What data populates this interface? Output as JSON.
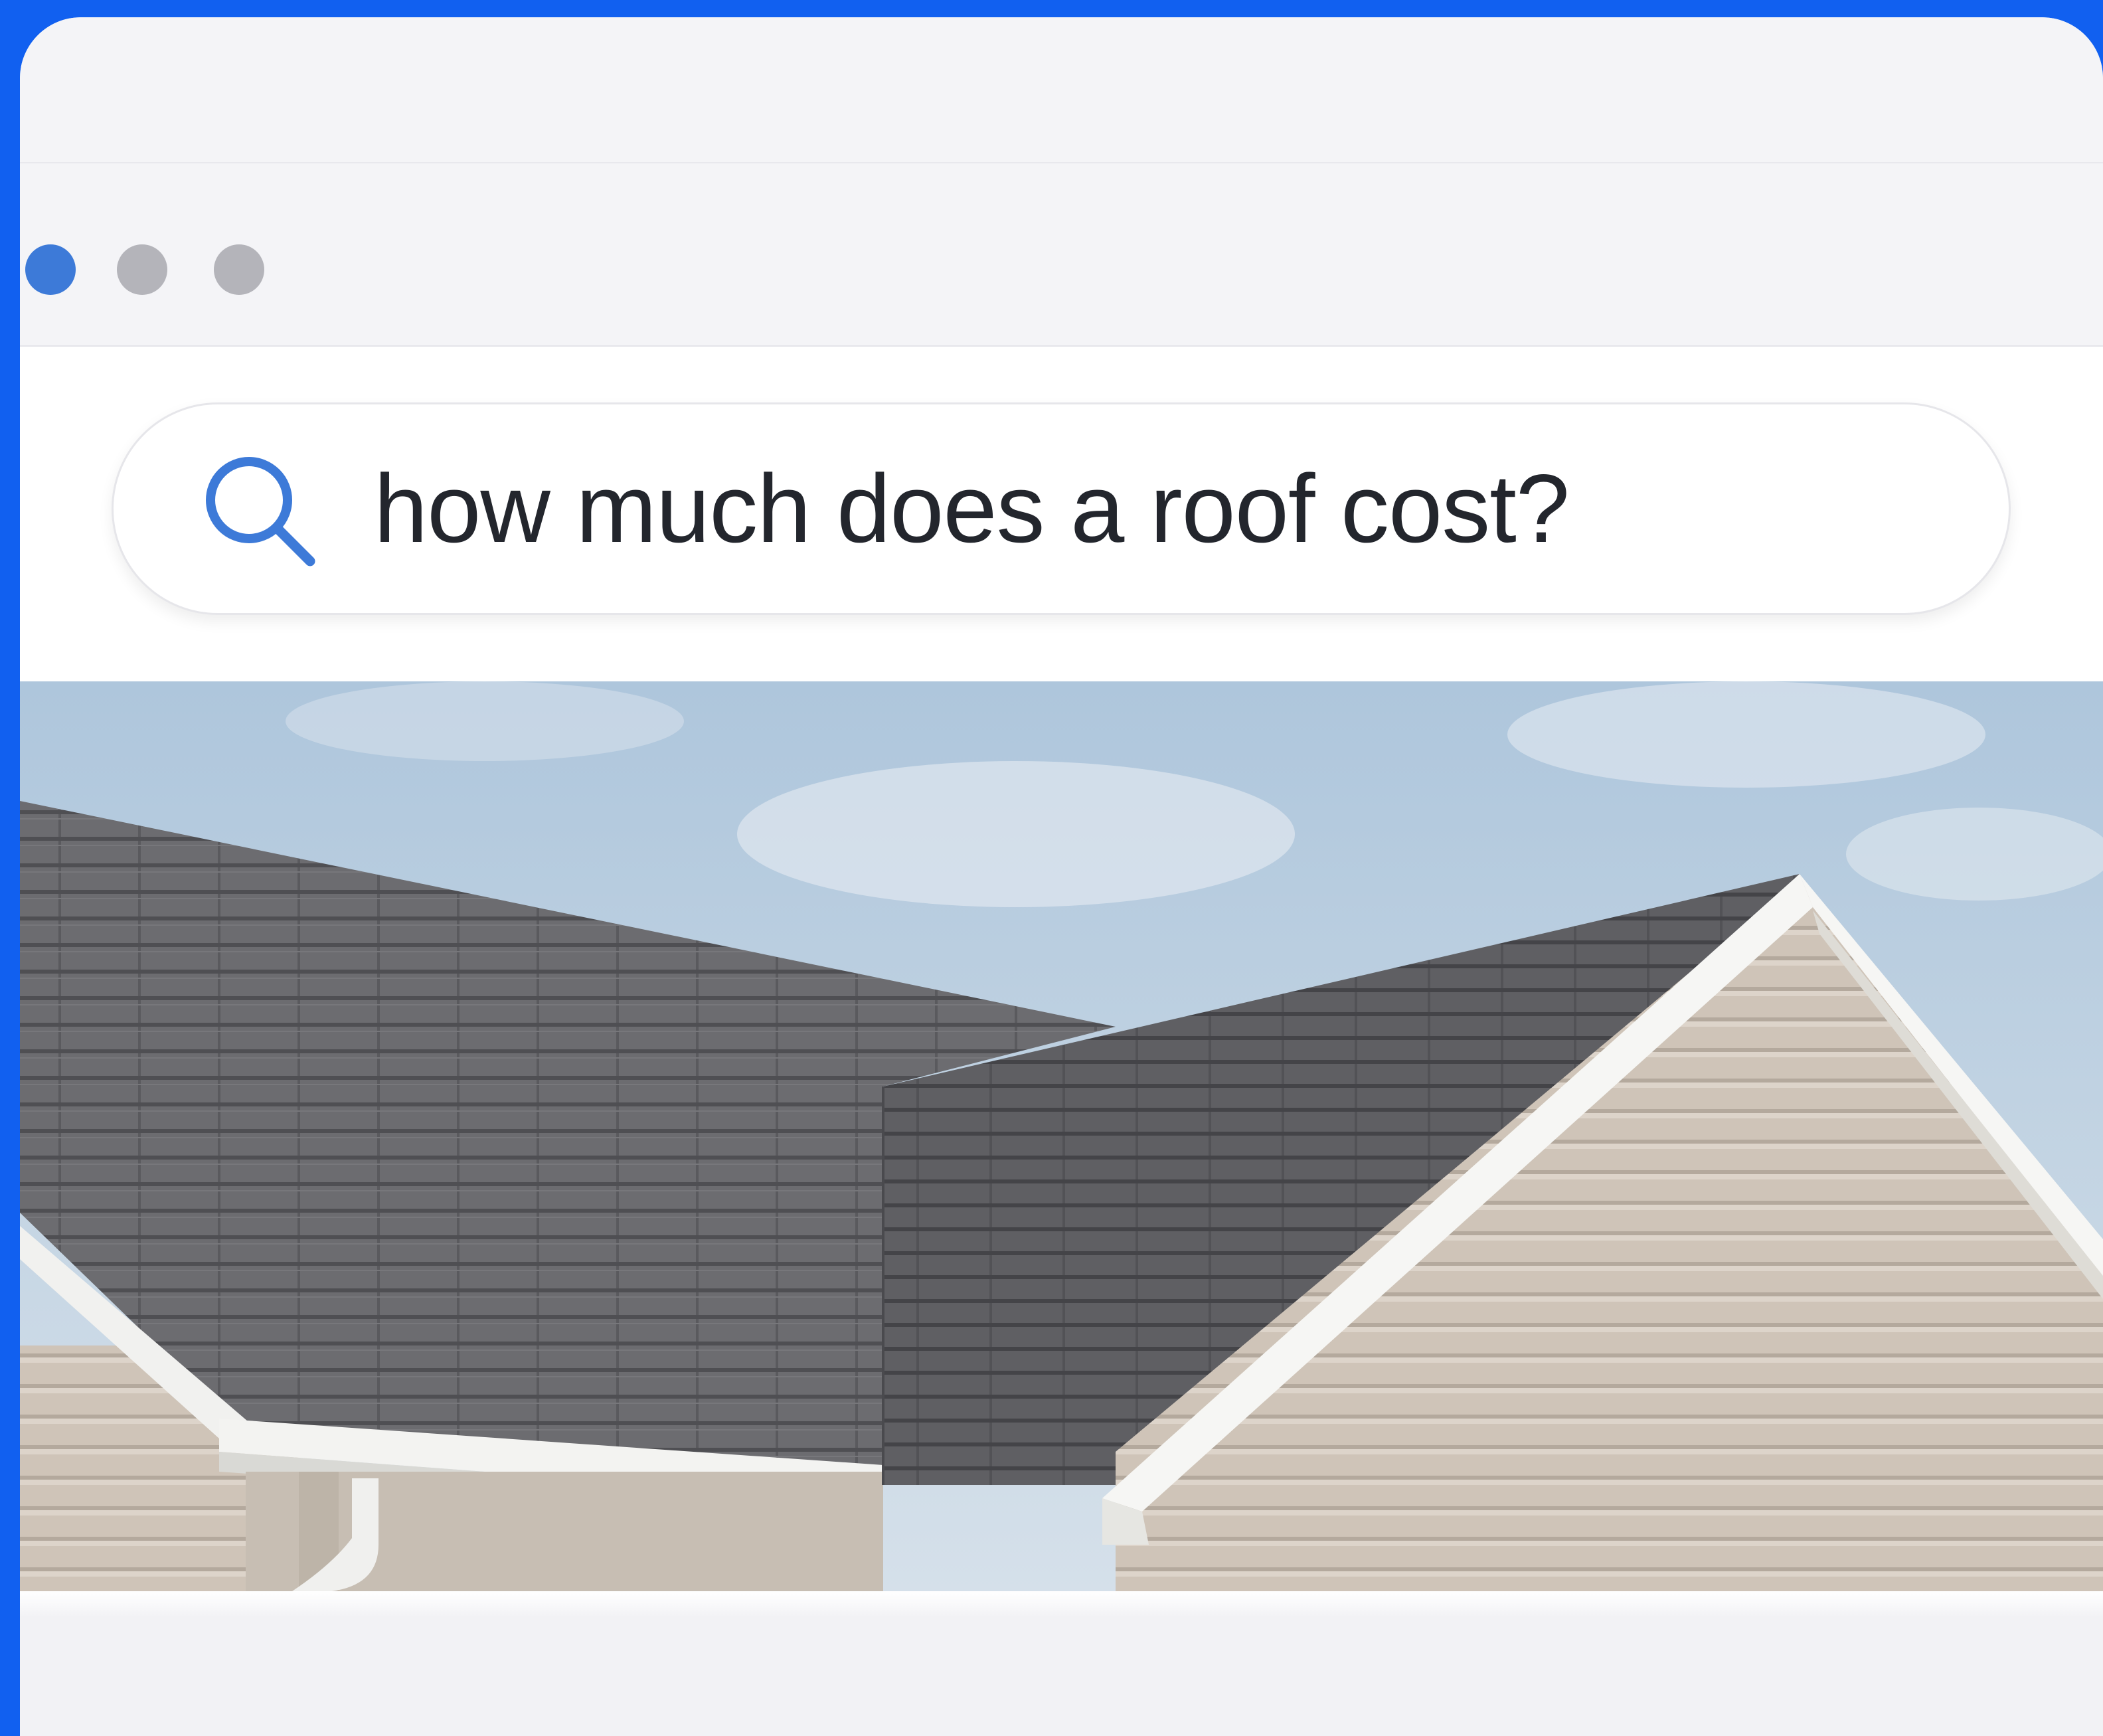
{
  "window": {
    "controls": [
      "active-dot",
      "inactive-dot",
      "inactive-dot"
    ]
  },
  "search": {
    "query": "how much does a roof cost?",
    "icon": "search-icon"
  },
  "image": {
    "subject": "house-roof-photo"
  },
  "colors": {
    "frame": "#1160f0",
    "accent": "#3d7ad8",
    "text": "#23262d"
  }
}
